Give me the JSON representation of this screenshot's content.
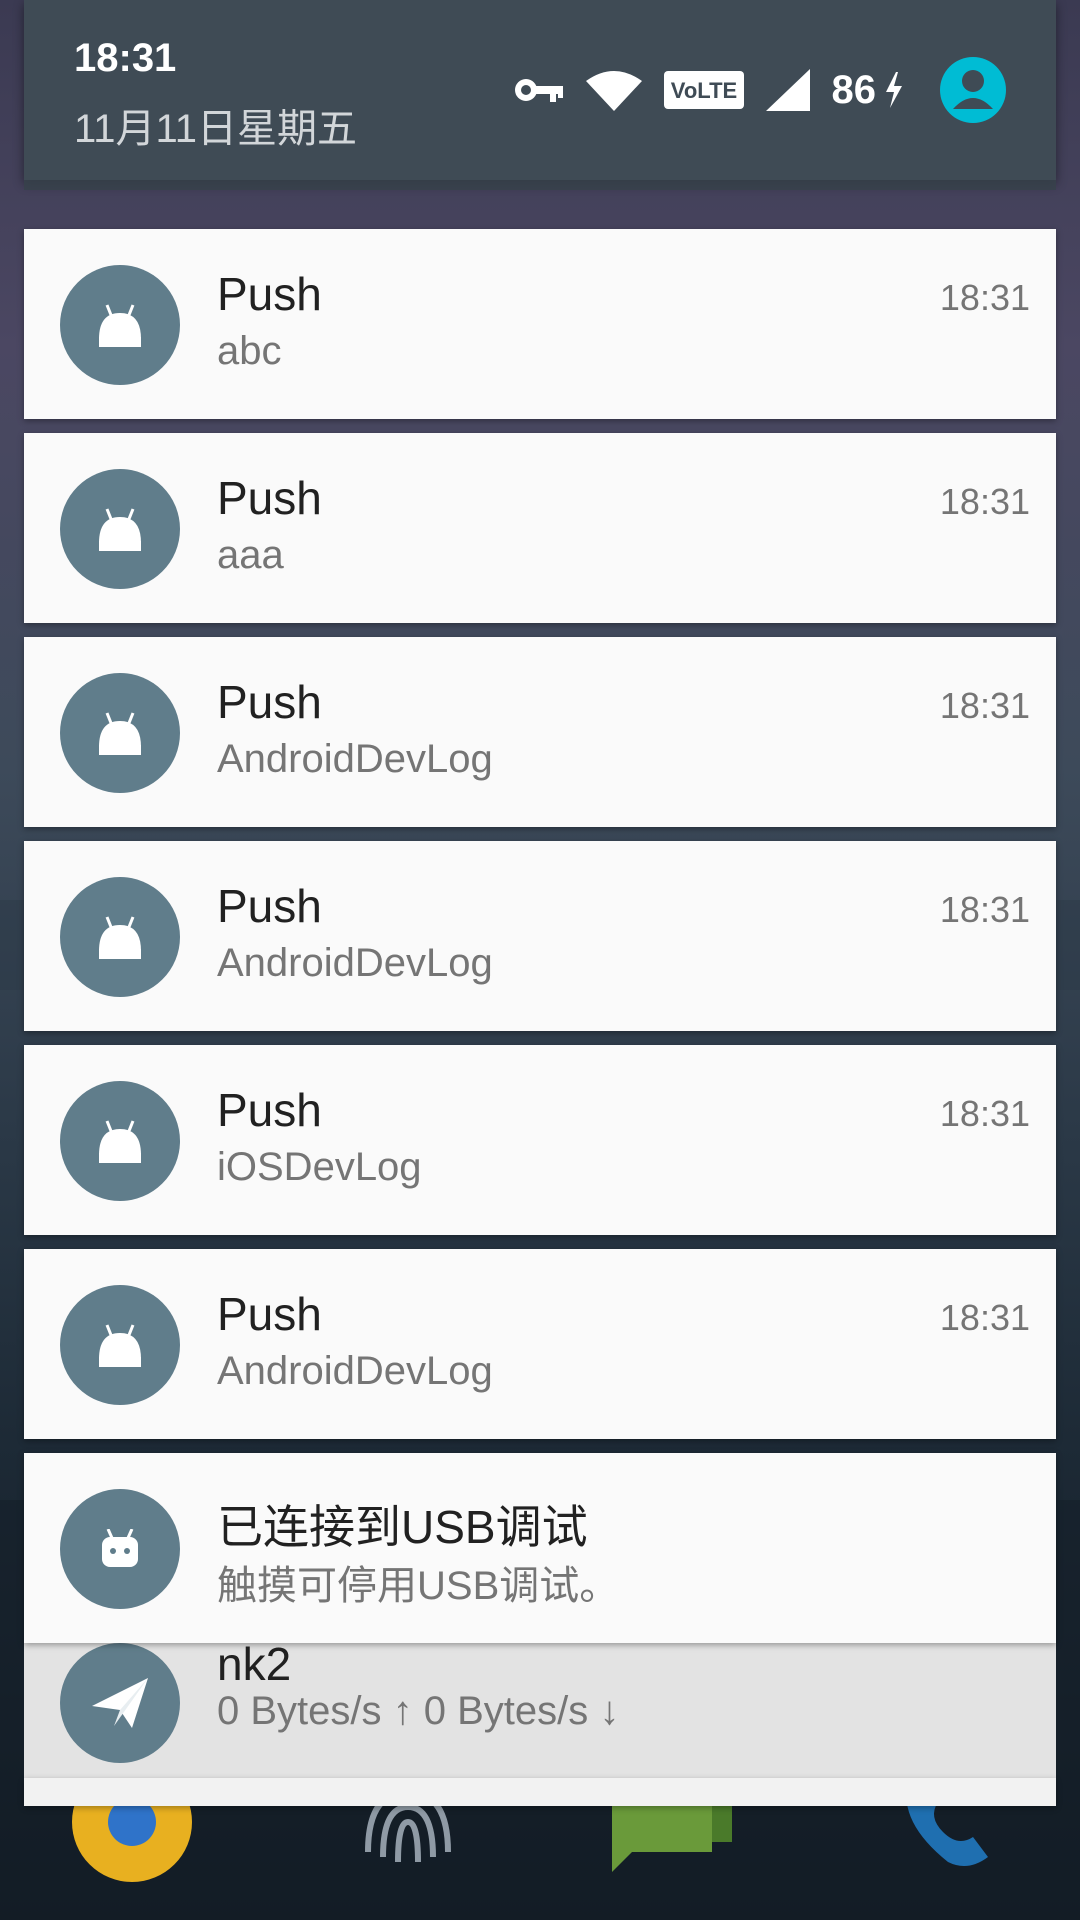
{
  "header": {
    "time": "18:31",
    "date": "11月11日星期五",
    "battery": "86",
    "network_badge": "VoLTE",
    "icons": [
      "vpn-key-icon",
      "wifi-icon",
      "volte-icon",
      "signal-icon",
      "charging-icon",
      "user-account-icon"
    ],
    "accent_color": "#00bcd4"
  },
  "notifications": [
    {
      "title": "Push",
      "text": "abc",
      "time": "18:31",
      "icon": "android-icon"
    },
    {
      "title": "Push",
      "text": "aaa",
      "time": "18:31",
      "icon": "android-icon"
    },
    {
      "title": "Push",
      "text": "AndroidDevLog",
      "time": "18:31",
      "icon": "android-icon"
    },
    {
      "title": "Push",
      "text": "AndroidDevLog",
      "time": "18:31",
      "icon": "android-icon"
    },
    {
      "title": "Push",
      "text": "iOSDevLog",
      "time": "18:31",
      "icon": "android-icon"
    },
    {
      "title": "Push",
      "text": "AndroidDevLog",
      "time": "18:31",
      "icon": "android-icon"
    }
  ],
  "usb_notification": {
    "title": "已连接到USB调试",
    "text": "触摸可停用USB调试。",
    "icon": "android-debug-icon"
  },
  "speed_notification": {
    "title": "nk2",
    "text": "0 Bytes/s ↑ 0 Bytes/s ↓",
    "icon": "send-icon"
  },
  "colors": {
    "notification_icon_bg": "#607d8b",
    "header_bg": "#3f4b55",
    "card_bg": "#fafafa"
  }
}
